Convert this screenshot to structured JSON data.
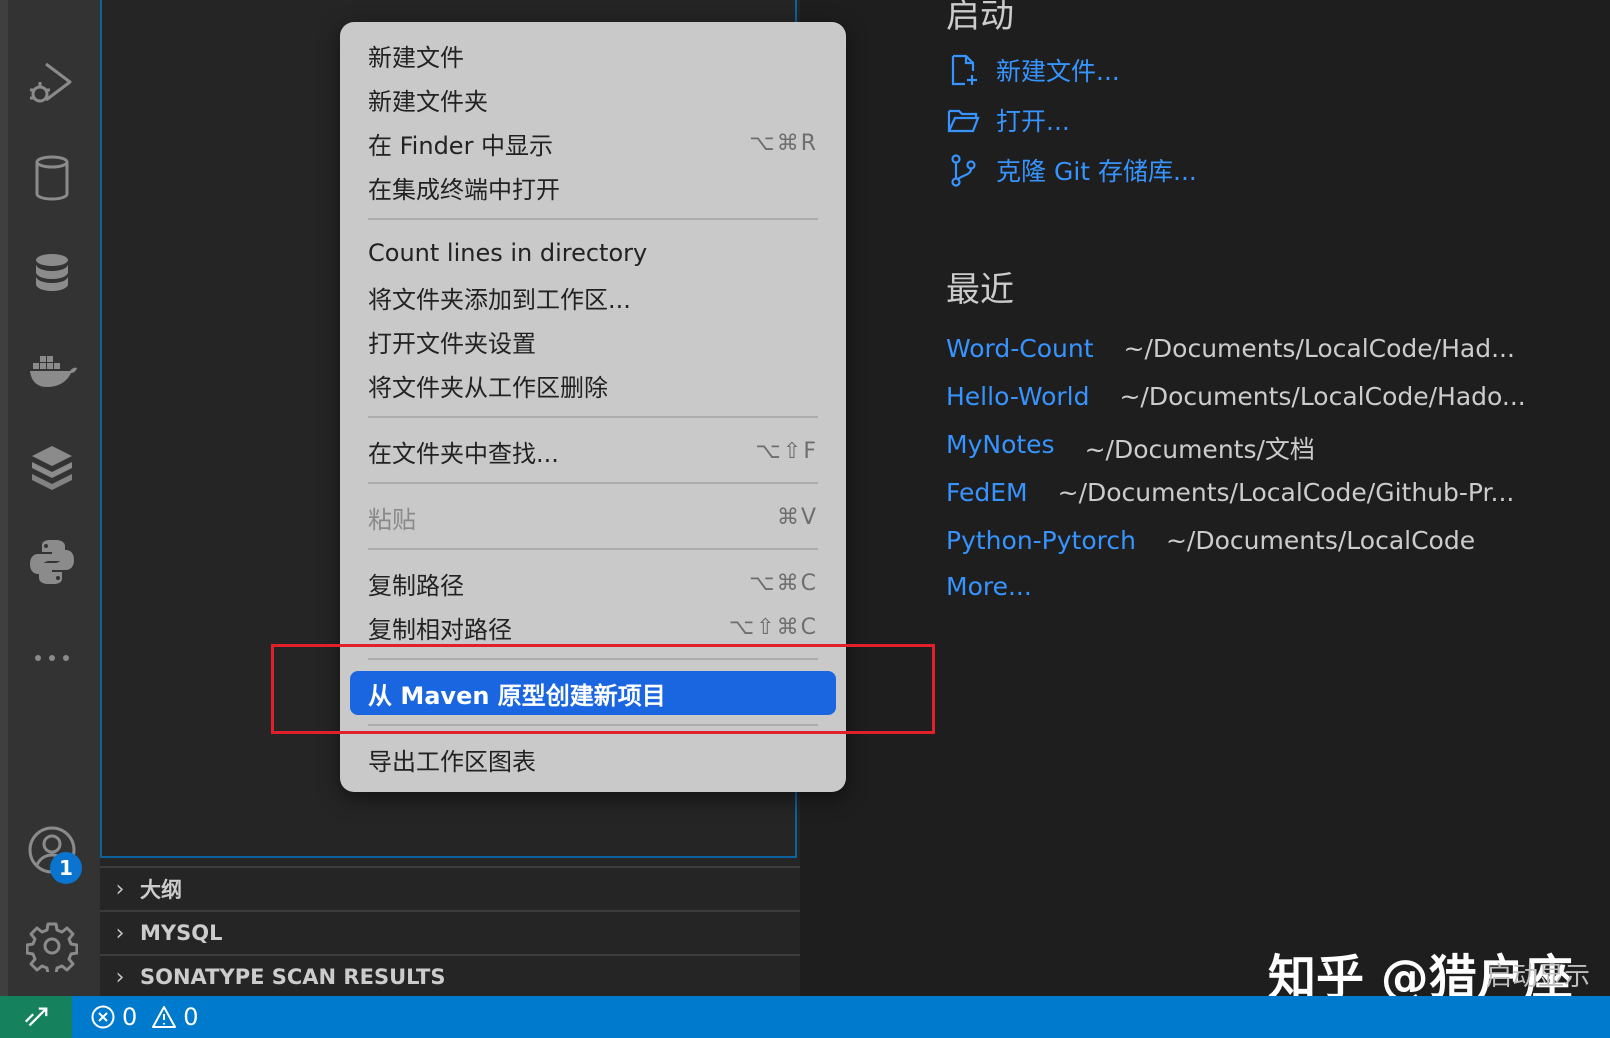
{
  "welcome": {
    "start_heading": "启动",
    "start_items": [
      {
        "icon": "new-file-icon",
        "label": "新建文件..."
      },
      {
        "icon": "open-folder-icon",
        "label": "打开..."
      },
      {
        "icon": "git-branch-icon",
        "label": "克隆 Git 存储库..."
      }
    ],
    "recent_heading": "最近",
    "recent": [
      {
        "name": "Word-Count",
        "path": "~/Documents/LocalCode/Had..."
      },
      {
        "name": "Hello-World",
        "path": "~/Documents/LocalCode/Hado..."
      },
      {
        "name": "MyNotes",
        "path": "~/Documents/文档"
      },
      {
        "name": "FedEM",
        "path": "~/Documents/LocalCode/Github-Pr..."
      },
      {
        "name": "Python-Pytorch",
        "path": "~/Documents/LocalCode"
      }
    ],
    "more_label": "More..."
  },
  "context_menu": {
    "items": [
      {
        "label": "新建文件",
        "shortcut": ""
      },
      {
        "label": "新建文件夹",
        "shortcut": ""
      },
      {
        "label": "在 Finder 中显示",
        "shortcut": "⌥⌘R"
      },
      {
        "label": "在集成终端中打开",
        "shortcut": ""
      },
      {
        "label": "Count lines in directory",
        "shortcut": ""
      },
      {
        "label": "将文件夹添加到工作区...",
        "shortcut": ""
      },
      {
        "label": "打开文件夹设置",
        "shortcut": ""
      },
      {
        "label": "将文件夹从工作区删除",
        "shortcut": ""
      },
      {
        "label": "在文件夹中查找...",
        "shortcut": "⌥⇧F"
      },
      {
        "label": "粘贴",
        "shortcut": "⌘V"
      },
      {
        "label": "复制路径",
        "shortcut": "⌥⌘C"
      },
      {
        "label": "复制相对路径",
        "shortcut": "⌥⇧⌘C"
      },
      {
        "label": "从 Maven 原型创建新项目",
        "shortcut": ""
      },
      {
        "label": "导出工作区图表",
        "shortcut": ""
      }
    ]
  },
  "sidebar_sections": [
    "大纲",
    "MYSQL",
    "SONATYPE SCAN RESULTS"
  ],
  "activity_bar": {
    "icons": [
      "run-debug-icon",
      "database-cylinder-icon",
      "database-stack-icon",
      "docker-icon",
      "layers-icon",
      "python-icon",
      "more-icon",
      "account-icon",
      "settings-icon"
    ],
    "account_badge": "1"
  },
  "status_bar": {
    "errors": "0",
    "warnings": "0"
  },
  "watermark": {
    "text": "知乎 @猎户座",
    "sub": "启动显示"
  },
  "colors": {
    "accent": "#007acc",
    "link": "#3794ff",
    "menu_selected": "#1a66e0",
    "highlight_box": "#e0202a",
    "remote": "#16825d"
  }
}
